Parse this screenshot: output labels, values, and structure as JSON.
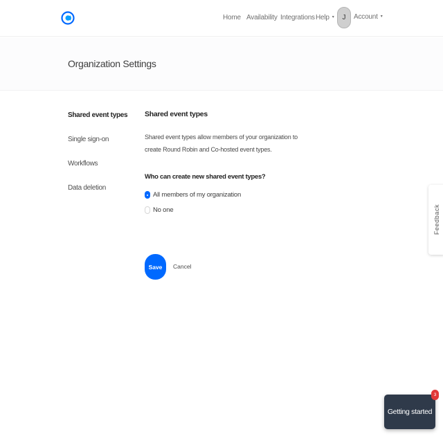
{
  "topbar": {
    "logo_icon": "calendly-logo-icon",
    "nav": {
      "home": "Home",
      "availability": "Availability",
      "integrations": "Integrations",
      "help": "Help",
      "account": "Account"
    },
    "avatar_initial": "J",
    "caret_glyph": "▾"
  },
  "page": {
    "title": "Organization Settings"
  },
  "sidebar": {
    "items": [
      {
        "label": "Shared event types",
        "active": true
      },
      {
        "label": "Single sign-on",
        "active": false
      },
      {
        "label": "Workflows",
        "active": false
      },
      {
        "label": "Data deletion",
        "active": false
      }
    ]
  },
  "content": {
    "section_title": "Shared event types",
    "description": "Shared event types allow members of your organization to create Round Robin and Co-hosted event types.",
    "question": "Who can create new shared event types?",
    "options": [
      {
        "label": "All members of my organization",
        "selected": true
      },
      {
        "label": "No one",
        "selected": false
      }
    ],
    "save_label": "Save",
    "cancel_label": "Cancel"
  },
  "feedback": {
    "label": "Feedback"
  },
  "getting_started": {
    "label": "Getting started",
    "badge_count": "3"
  },
  "colors": {
    "primary": "#0069ff",
    "dark_button": "#2f3a4a",
    "badge": "#e23838"
  }
}
